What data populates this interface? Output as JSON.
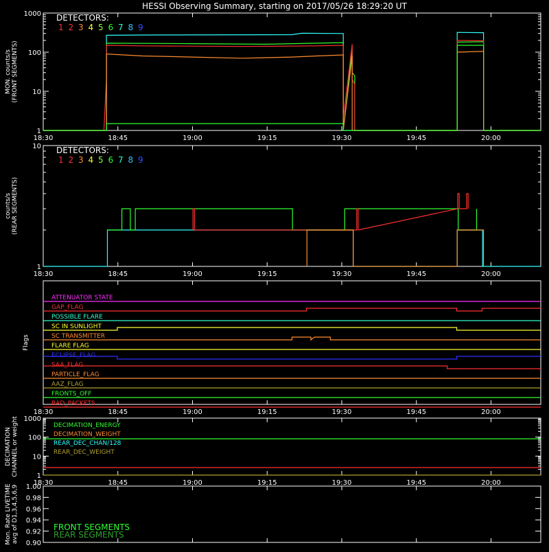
{
  "title": "HESSI Observing Summary, starting on 2017/05/26 18:29:20 UT",
  "time_ticks": [
    "18:30",
    "18:45",
    "19:00",
    "19:15",
    "19:30",
    "19:45",
    "20:00"
  ],
  "time_tick_minutes": [
    0,
    15,
    30,
    45,
    60,
    75,
    90
  ],
  "time_range_minutes": [
    0,
    100
  ],
  "detector_colors": [
    "#ff3030",
    "#ff3030",
    "#ff8c30",
    "#ffff30",
    "#8cff30",
    "#30ff30",
    "#30ffd0",
    "#30c8ff",
    "#3050ff"
  ],
  "chart_data": [
    {
      "type": "line",
      "panel": "front",
      "ylabel": "MON. counts/s (FRONT SEGMENTS)",
      "ylabel_lines": [
        "MON. counts/s",
        "(FRONT SEGMENTS)"
      ],
      "yscale": "log",
      "ylim": [
        1,
        1000
      ],
      "y_tick_values": [
        1,
        10,
        100,
        1000
      ],
      "y_tick_labels": [
        "1",
        "10",
        "100",
        "1000"
      ],
      "legend_title": "DETECTORS:",
      "legend_labels": [
        "1",
        "2",
        "3",
        "4",
        "5",
        "6",
        "7",
        "8",
        "9"
      ],
      "legend_colors": [
        "#ff3030",
        "#ff3030",
        "#ff8c30",
        "#ffff30",
        "#8cff30",
        "#30ff30",
        "#30ffd0",
        "#30c8ff",
        "#3050ff"
      ],
      "series": [
        {
          "color": "#30ffff",
          "x": [
            0,
            12.7,
            12.7,
            20,
            50,
            52,
            60.3,
            60.3,
            62.4,
            62.4,
            83.2,
            83.2,
            88.5,
            88.5,
            100
          ],
          "y": [
            1,
            1,
            270,
            275,
            280,
            305,
            300,
            1,
            1,
            1,
            1,
            320,
            315,
            1,
            1
          ]
        },
        {
          "color": "#30ff30",
          "x": [
            0,
            12.7,
            12.7,
            30,
            45,
            55,
            60.3,
            60.3,
            62.1,
            62.1,
            62.6,
            62.6,
            83.2,
            83.2,
            88.5,
            88.5,
            100
          ],
          "y": [
            1,
            1,
            170,
            165,
            160,
            170,
            175,
            1,
            120,
            30,
            25,
            1,
            1,
            180,
            185,
            1,
            1
          ]
        },
        {
          "color": "#ff3030",
          "x": [
            0,
            12.2,
            12.7,
            12.7,
            20,
            40,
            55,
            60.3,
            60.3,
            62.1,
            62.1,
            62.6,
            62.6,
            83.2,
            83.2,
            88.5,
            88.5,
            100
          ],
          "y": [
            1,
            1,
            20,
            150,
            145,
            140,
            145,
            150,
            2,
            160,
            20,
            15,
            1,
            1,
            200,
            195,
            1,
            1
          ]
        },
        {
          "color": "#ff8c30",
          "x": [
            0,
            12.7,
            12.7,
            20,
            30,
            40,
            50,
            55,
            60.3,
            60.3,
            62.1,
            62.1,
            83.2,
            83.2,
            88.5,
            88.5,
            100
          ],
          "y": [
            1,
            1,
            90,
            80,
            75,
            70,
            75,
            80,
            85,
            1,
            80,
            1,
            1,
            100,
            105,
            1,
            1
          ]
        },
        {
          "color": "#30ff30",
          "x": [
            0,
            12.7,
            12.7,
            60.3,
            60.3,
            62.6,
            62.6,
            83.2,
            83.2,
            88.5,
            88.5,
            100
          ],
          "y": [
            1,
            1,
            1.5,
            1.5,
            1,
            1,
            1,
            1,
            150,
            150,
            1,
            1
          ]
        }
      ]
    },
    {
      "type": "line",
      "panel": "rear",
      "ylabel": "counts/s (REAR SEGMENTS)",
      "ylabel_lines": [
        "counts/s",
        "(REAR SEGMENTS)"
      ],
      "yscale": "log",
      "ylim": [
        1,
        10
      ],
      "y_tick_values": [
        1,
        10
      ],
      "y_tick_labels": [
        "1",
        "10"
      ],
      "legend_title": "DETECTORS:",
      "legend_labels": [
        "1",
        "2",
        "3",
        "4",
        "5",
        "6",
        "7",
        "8",
        "9"
      ],
      "legend_colors": [
        "#ff3030",
        "#ff3030",
        "#ff8c30",
        "#ffff30",
        "#8cff30",
        "#30ff30",
        "#30ffd0",
        "#30c8ff",
        "#3050ff"
      ],
      "series": [
        {
          "color": "#30ffff",
          "x": [
            0,
            12.9,
            12.9,
            62.3,
            62.3,
            83.2,
            83.2,
            88.3,
            88.3,
            100
          ],
          "y": [
            1,
            1,
            2,
            2,
            1,
            1,
            2,
            2,
            1,
            1
          ]
        },
        {
          "color": "#30ff30",
          "x": [
            12.9,
            15.8,
            15.8,
            17.5,
            17.5,
            18.5,
            18.5,
            50.1,
            50.1,
            60.6,
            60.6,
            83.4,
            83.4,
            87.1,
            87.1
          ],
          "y": [
            2,
            2,
            3,
            3,
            2,
            2,
            3,
            3,
            2,
            2,
            3,
            3,
            2,
            2,
            3
          ]
        },
        {
          "color": "#ff3030",
          "x": [
            30.1,
            30.1,
            30.4,
            30.4,
            63.0,
            63.0,
            63.3,
            63.3,
            83.3,
            83.3,
            83.6,
            83.6,
            85.1,
            85.1,
            85.4,
            85.4
          ],
          "y": [
            2,
            3,
            3,
            2,
            2,
            3,
            3,
            2,
            3,
            4,
            4,
            3,
            3,
            4,
            4,
            3
          ]
        },
        {
          "color": "#ff8c30",
          "x": [
            53.0,
            53.0,
            62.3,
            62.3,
            83.2,
            83.2,
            88.5,
            88.5
          ],
          "y": [
            1,
            2,
            2,
            1,
            1,
            2,
            2,
            1
          ]
        }
      ]
    },
    {
      "type": "line",
      "panel": "flags",
      "ylabel": "Flags",
      "flags": [
        {
          "name": "ATTENUATOR STATE",
          "color": "#ff30ff",
          "x": [
            0,
            100
          ],
          "state": [
            0,
            0
          ]
        },
        {
          "name": "GAP_FLAG",
          "color": "#ff3030",
          "x": [
            0,
            52.9,
            52.9,
            83.1,
            83.1,
            88.2,
            88.2,
            100
          ],
          "state": [
            0,
            0,
            1,
            1,
            0,
            0,
            1,
            1
          ]
        },
        {
          "name": "POSSIBLE FLARE",
          "color": "#30ffd0",
          "x": [
            0,
            100
          ],
          "state": [
            0,
            0
          ]
        },
        {
          "name": "SC IN SUNLIGHT",
          "color": "#ffff30",
          "x": [
            0,
            14.9,
            14.9,
            83.1,
            83.1,
            100
          ],
          "state": [
            0,
            0,
            1,
            1,
            0,
            0
          ]
        },
        {
          "name": "SC TRANSMITTER",
          "color": "#ff8c30",
          "x": [
            0,
            50.0,
            50.0,
            53.8,
            53.8,
            54.5,
            54.5,
            57.7,
            57.7,
            100
          ],
          "state": [
            0,
            0,
            1,
            1,
            0,
            1,
            1,
            1,
            0,
            0
          ]
        },
        {
          "name": "FLARE FLAG",
          "color": "#ffff30",
          "x": [
            0,
            100
          ],
          "state": [
            0,
            0
          ]
        },
        {
          "name": "ECLIPSE_FLAG",
          "color": "#3030ff",
          "x": [
            0,
            14.9,
            14.9,
            83.1,
            83.1,
            100
          ],
          "state": [
            1,
            1,
            0,
            0,
            1,
            1
          ]
        },
        {
          "name": "SAA_FLAG",
          "color": "#ff3030",
          "x": [
            0,
            81.2,
            81.2,
            100
          ],
          "state": [
            1,
            1,
            0,
            0
          ]
        },
        {
          "name": "PARTICLE_FLAG",
          "color": "#ff8c30",
          "x": [
            0,
            100
          ],
          "state": [
            0,
            0
          ]
        },
        {
          "name": "AAZ_FLAG",
          "color": "#b0a030",
          "x": [
            0,
            100
          ],
          "state": [
            0,
            0
          ]
        },
        {
          "name": "FRONTS_OFF",
          "color": "#30ff30",
          "x": [
            0,
            100
          ],
          "state": [
            0,
            0
          ]
        },
        {
          "name": "BAD_PACKETS",
          "color": "#ff3030",
          "x": [
            0,
            100
          ],
          "state": [
            0,
            0
          ]
        }
      ]
    },
    {
      "type": "line",
      "panel": "decimation",
      "ylabel": "DECIMATION CHANNEL or weight",
      "ylabel_lines": [
        "DECIMATION",
        "CHANNEL or weight"
      ],
      "yscale": "log",
      "ylim": [
        1,
        1000
      ],
      "y_tick_values": [
        1,
        10,
        100,
        1000
      ],
      "y_tick_labels": [
        "1",
        "10",
        "100",
        "1000"
      ],
      "legend_labels": [
        "DECIMATION_ENERGY",
        "DECIMATION_WEIGHT",
        "REAR_DEC_CHAN/128",
        "REAR_DEC_WEIGHT"
      ],
      "legend_colors": [
        "#30ff30",
        "#ff8c30",
        "#30ffff",
        "#b0a030"
      ],
      "series": [
        {
          "color": "#30ff30",
          "x": [
            0,
            100
          ],
          "y": [
            82,
            82
          ]
        },
        {
          "color": "#ff3030",
          "x": [
            0,
            100
          ],
          "y": [
            2.5,
            2.5
          ]
        },
        {
          "color": "#b0a030",
          "x": [
            0,
            100
          ],
          "y": [
            1,
            1
          ]
        }
      ]
    },
    {
      "type": "line",
      "panel": "livetime",
      "ylabel": "Mon. Rate LIVETIME avg of D1,3,4,5,6,9",
      "ylabel_lines": [
        "Mon. Rate LIVETIME",
        "avg of D1,3,4,5,6,9"
      ],
      "ylim": [
        0.9,
        1.0
      ],
      "y_tick_values": [
        0.9,
        0.92,
        0.94,
        0.96,
        0.98,
        1.0
      ],
      "y_tick_labels": [
        "0.90",
        "0.92",
        "0.94",
        "0.96",
        "0.98",
        "1.00"
      ],
      "legend_labels": [
        "FRONT SEGMENTS",
        "REAR SEGMENTS"
      ],
      "legend_colors": [
        "#30ff30",
        "#30a030"
      ]
    }
  ]
}
